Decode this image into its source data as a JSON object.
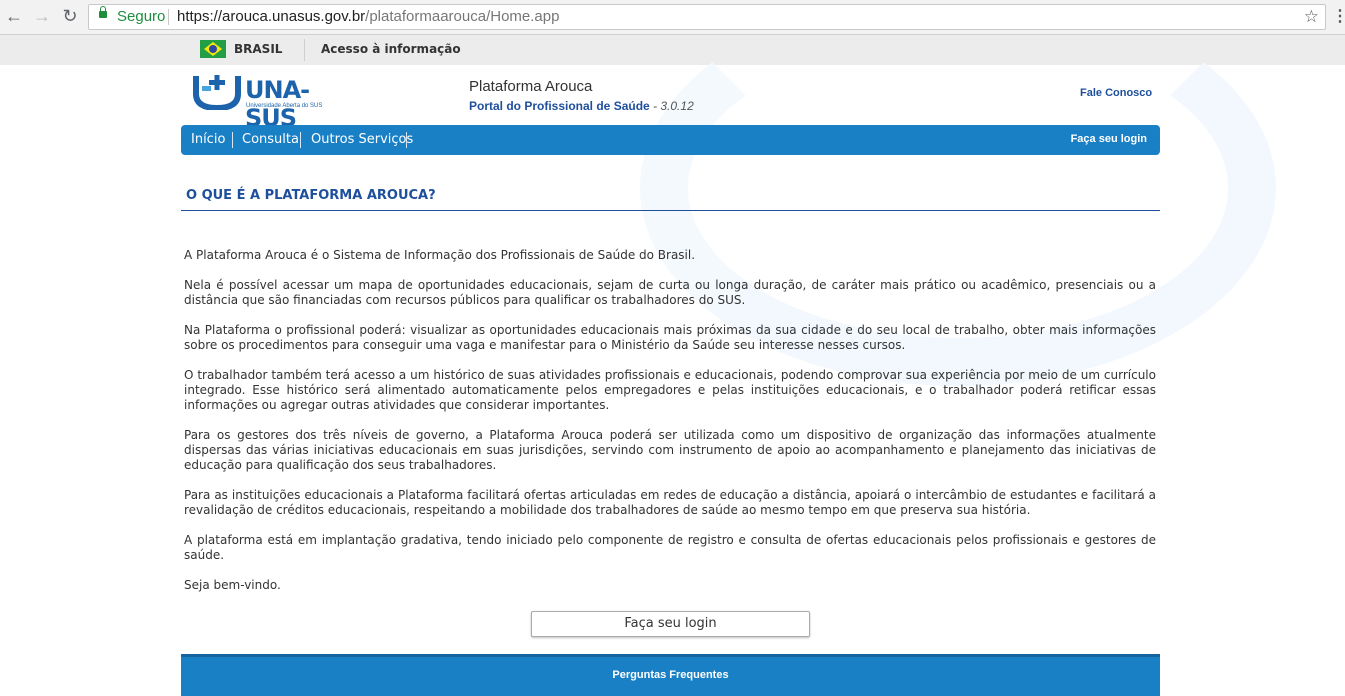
{
  "browser": {
    "secure_label": "Seguro",
    "url_host": "https://arouca.unasus.gov.br",
    "url_path": "/plataformaarouca/Home.app",
    "back_icon": "arrow-left-icon",
    "forward_icon": "arrow-right-icon",
    "reload_icon": "reload-icon",
    "bookmark_icon": "star-icon",
    "menu_icon": "kebab-menu-icon"
  },
  "govbar": {
    "country": "BRASIL",
    "access_info": "Acesso à informação"
  },
  "header": {
    "logo_text": "UNA-SUS",
    "logo_subtitle": "Universidade Aberta do SUS",
    "platform_name": "Plataforma Arouca",
    "portal_label": "Portal do Profissional de Saúde",
    "version": "- 3.0.12",
    "contact_link": "Fale Conosco"
  },
  "nav": {
    "items": [
      {
        "label": "Início"
      },
      {
        "label": "Consulta"
      },
      {
        "label": "Outros Serviços"
      }
    ],
    "login_link": "Faça seu login"
  },
  "main": {
    "title": "O QUE É A PLATAFORMA AROUCA?",
    "paragraphs": [
      "A Plataforma Arouca é o Sistema de Informação dos Profissionais de Saúde do Brasil.",
      "Nela é possível acessar um mapa de oportunidades educacionais, sejam de curta ou longa duração, de caráter mais prático ou acadêmico, presenciais ou a distância que são financiadas com recursos públicos para qualificar os trabalhadores do SUS.",
      "Na Plataforma o profissional poderá: visualizar as oportunidades educacionais mais próximas da sua cidade e do seu local de trabalho, obter mais informações sobre os procedimentos para conseguir uma vaga e manifestar para o Ministério da Saúde seu interesse nesses cursos.",
      "O trabalhador também terá acesso a um histórico de suas atividades profissionais e educacionais, podendo comprovar sua experiência por meio de um currículo integrado. Esse histórico será alimentado automaticamente pelos empregadores e pelas instituições educacionais, e o trabalhador poderá retificar essas informações ou agregar outras atividades que considerar importantes.",
      "Para os gestores dos três níveis de governo, a Plataforma Arouca poderá ser utilizada como um dispositivo de organização das informações atualmente dispersas das várias iniciativas educacionais em suas jurisdições, servindo com instrumento de apoio ao acompanhamento e planejamento das iniciativas de educação para qualificação dos seus trabalhadores.",
      "Para as instituições educacionais a Plataforma facilitará ofertas articuladas em redes de educação a distância, apoiará o intercâmbio de estudantes e facilitará a revalidação de créditos educacionais, respeitando a mobilidade dos trabalhadores de saúde ao mesmo tempo em que preserva sua história.",
      "A plataforma está em implantação gradativa, tendo iniciado pelo componente de registro e consulta de ofertas educacionais pelos profissionais e gestores de saúde.",
      "Seja bem-vindo."
    ],
    "login_button": "Faça seu login"
  },
  "footer": {
    "faq_label": "Perguntas Frequentes"
  },
  "colors": {
    "accent_blue": "#1a80c6",
    "title_blue": "#1e4f9c",
    "secure_green": "#1e8e3e"
  }
}
